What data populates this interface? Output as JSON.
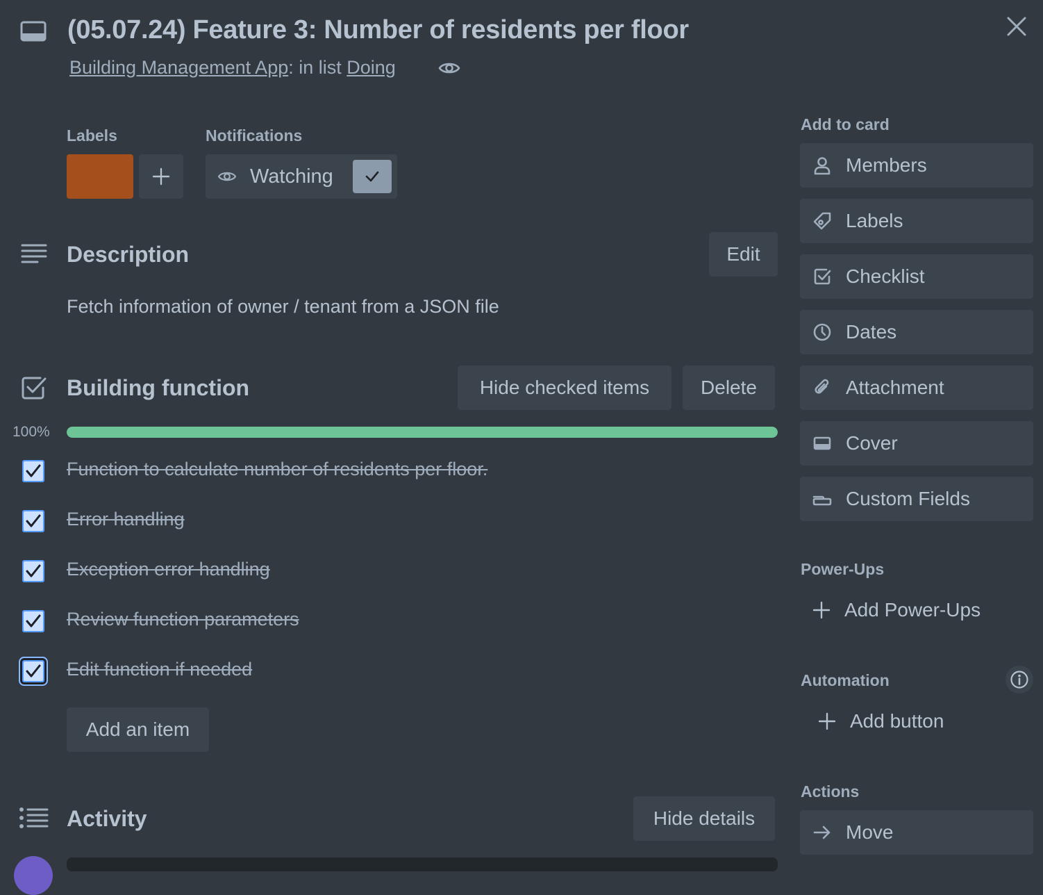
{
  "card": {
    "title": "(05.07.24) Feature 3: Number of residents per floor",
    "board_link": "Building Management App",
    "in_list_text": ": in list ",
    "list_link": "Doing"
  },
  "labels_section": {
    "heading": "Labels",
    "label_color": "#a54f1c"
  },
  "notifications": {
    "heading": "Notifications",
    "watch_label": "Watching",
    "watching": true
  },
  "description": {
    "heading": "Description",
    "edit_label": "Edit",
    "text": "Fetch information of owner / tenant from a JSON file"
  },
  "checklist": {
    "title": "Building function",
    "hide_checked_label": "Hide checked items",
    "delete_label": "Delete",
    "progress_text": "100%",
    "progress": 1.0,
    "items": [
      {
        "text": "Function to calculate number of residents per floor.",
        "checked": true
      },
      {
        "text": "Error handling",
        "checked": true
      },
      {
        "text": "Exception error handling",
        "checked": true
      },
      {
        "text": "Review function parameters",
        "checked": true
      },
      {
        "text": "Edit function if needed",
        "checked": true
      }
    ],
    "add_item_label": "Add an item"
  },
  "activity": {
    "heading": "Activity",
    "hide_details_label": "Hide details"
  },
  "sidebar": {
    "add_to_card_heading": "Add to card",
    "add_to_card": [
      {
        "label": "Members",
        "icon": "person-icon"
      },
      {
        "label": "Labels",
        "icon": "tag-icon"
      },
      {
        "label": "Checklist",
        "icon": "checklist-icon"
      },
      {
        "label": "Dates",
        "icon": "clock-icon"
      },
      {
        "label": "Attachment",
        "icon": "paperclip-icon"
      },
      {
        "label": "Cover",
        "icon": "cover-icon"
      },
      {
        "label": "Custom Fields",
        "icon": "custom-fields-icon"
      }
    ],
    "power_ups_heading": "Power-Ups",
    "add_power_ups_label": "Add Power-Ups",
    "automation_heading": "Automation",
    "add_button_label": "Add button",
    "actions_heading": "Actions",
    "move_label": "Move"
  },
  "colors": {
    "background": "#323940",
    "button": "#3b444c",
    "progress": "#6cc497",
    "checkbox": "#579dff"
  }
}
